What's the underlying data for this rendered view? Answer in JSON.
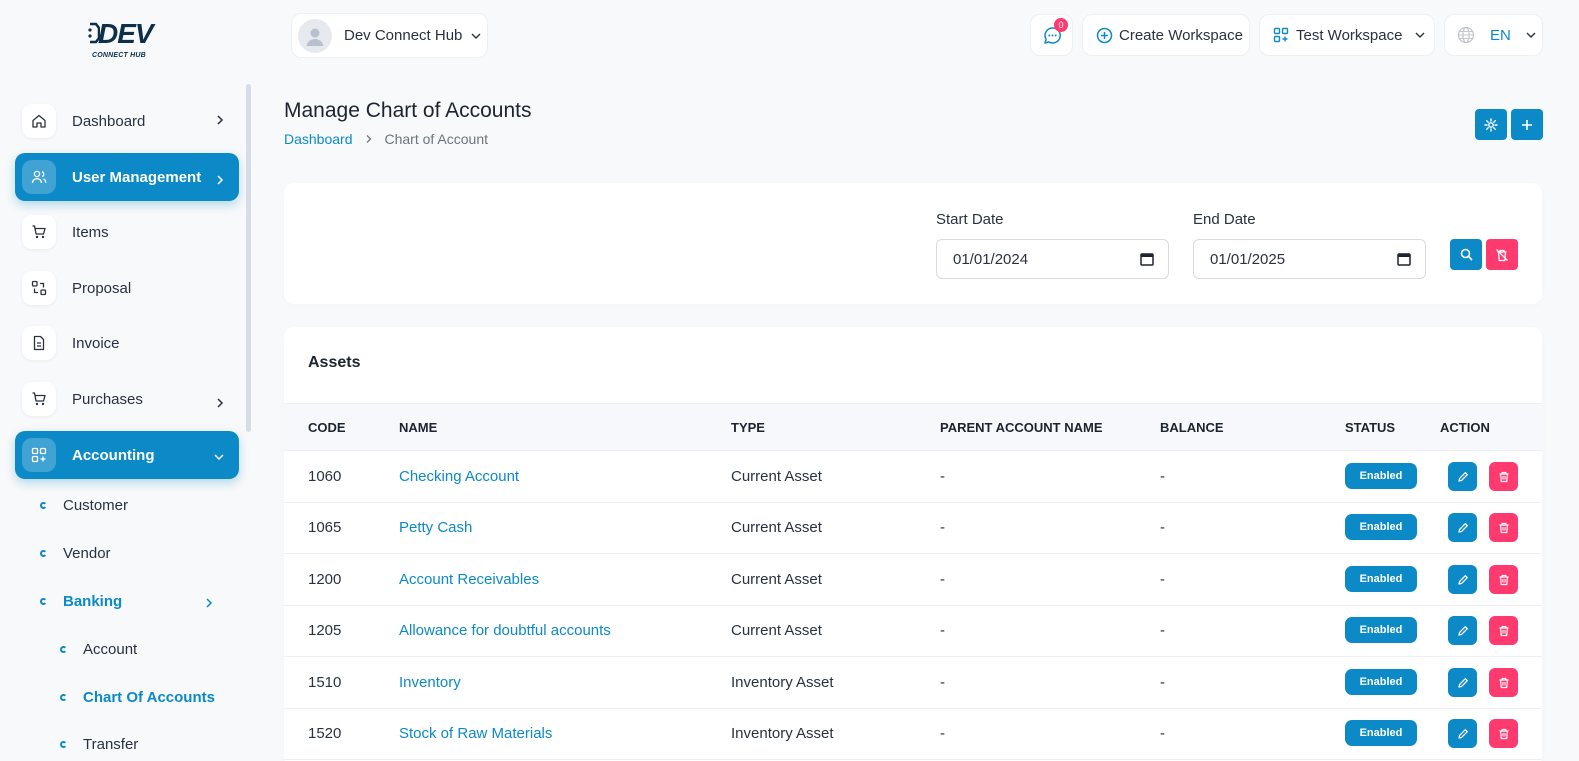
{
  "brand": {
    "logo_text": "DEV",
    "logo_sub": "CONNECT HUB"
  },
  "sidebar": {
    "items": [
      {
        "label": "Dashboard",
        "icon": "home-icon"
      },
      {
        "label": "User Management",
        "icon": "users-icon"
      },
      {
        "label": "Items",
        "icon": "cart-icon"
      },
      {
        "label": "Proposal",
        "icon": "swap-icon"
      },
      {
        "label": "Invoice",
        "icon": "file-icon"
      },
      {
        "label": "Purchases",
        "icon": "cart-icon"
      },
      {
        "label": "Accounting",
        "icon": "grid-plus-icon"
      }
    ],
    "sub_items": [
      {
        "label": "Customer"
      },
      {
        "label": "Vendor"
      },
      {
        "label": "Banking"
      },
      {
        "label": "Account"
      },
      {
        "label": "Chart Of Accounts"
      },
      {
        "label": "Transfer"
      }
    ]
  },
  "header": {
    "workspace_name": "Dev Connect Hub",
    "notification_count": "0",
    "create_workspace_label": "Create Workspace",
    "current_workspace_label": "Test Workspace",
    "language_label": "EN"
  },
  "page": {
    "title": "Manage Chart of Accounts",
    "breadcrumb": [
      "Dashboard",
      "Chart of Account"
    ]
  },
  "filters": {
    "start_label": "Start Date",
    "start_value": "01/01/2024",
    "end_label": "End Date",
    "end_value": "01/01/2025"
  },
  "table": {
    "title": "Assets",
    "columns": [
      "CODE",
      "NAME",
      "TYPE",
      "PARENT ACCOUNT NAME",
      "BALANCE",
      "STATUS",
      "ACTION"
    ],
    "rows": [
      {
        "code": "1060",
        "name": "Checking Account",
        "type": "Current Asset",
        "parent": "-",
        "balance": "-",
        "status": "Enabled"
      },
      {
        "code": "1065",
        "name": "Petty Cash",
        "type": "Current Asset",
        "parent": "-",
        "balance": "-",
        "status": "Enabled"
      },
      {
        "code": "1200",
        "name": "Account Receivables",
        "type": "Current Asset",
        "parent": "-",
        "balance": "-",
        "status": "Enabled"
      },
      {
        "code": "1205",
        "name": "Allowance for doubtful accounts",
        "type": "Current Asset",
        "parent": "-",
        "balance": "-",
        "status": "Enabled"
      },
      {
        "code": "1510",
        "name": "Inventory",
        "type": "Inventory Asset",
        "parent": "-",
        "balance": "-",
        "status": "Enabled"
      },
      {
        "code": "1520",
        "name": "Stock of Raw Materials",
        "type": "Inventory Asset",
        "parent": "-",
        "balance": "-",
        "status": "Enabled"
      }
    ]
  },
  "colors": {
    "accent": "#0c8ac8",
    "danger": "#ff3a6e",
    "text": "#293240"
  }
}
